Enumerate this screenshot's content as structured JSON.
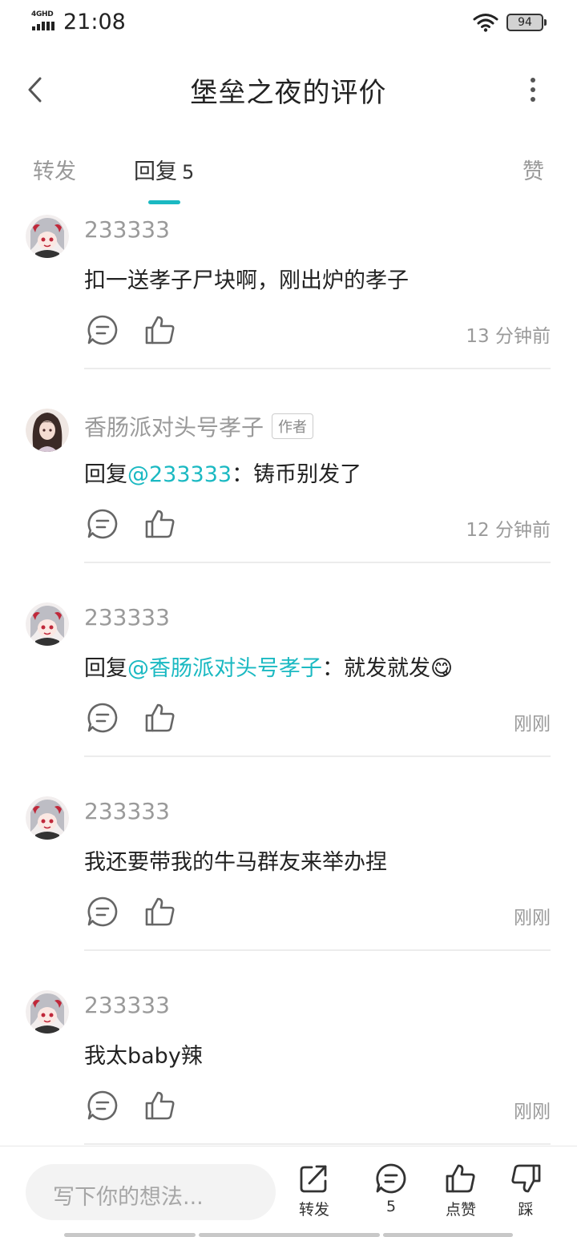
{
  "status_bar": {
    "network": "4GHD",
    "time": "21:08",
    "battery": "94"
  },
  "header": {
    "title": "堡垒之夜的评价"
  },
  "tabs": {
    "forward": "转发",
    "reply": "回复",
    "reply_count": "5",
    "like": "赞"
  },
  "colors": {
    "accent": "#1bb9c2",
    "muted": "#9a9a9a"
  },
  "comments": [
    {
      "user": "233333",
      "badge": "",
      "prefix": "",
      "mention": "",
      "separator": "",
      "text": "扣一送孝子尸块啊，刚出炉的孝子",
      "emoji": "",
      "time": "13 分钟前"
    },
    {
      "user": "香肠派对头号孝子",
      "badge": "作者",
      "prefix": "回复",
      "mention": "@233333",
      "separator": "：",
      "text": "铸币别发了",
      "emoji": "",
      "time": "12 分钟前"
    },
    {
      "user": "233333",
      "badge": "",
      "prefix": "回复",
      "mention": "@香肠派对头号孝子",
      "separator": "：",
      "text": "就发就发",
      "emoji": "😋",
      "time": "刚刚"
    },
    {
      "user": "233333",
      "badge": "",
      "prefix": "",
      "mention": "",
      "separator": "",
      "text": "我还要带我的牛马群友来举办捏",
      "emoji": "",
      "time": "刚刚"
    },
    {
      "user": "233333",
      "badge": "",
      "prefix": "",
      "mention": "",
      "separator": "",
      "text": "我太baby辣",
      "emoji": "",
      "time": "刚刚"
    }
  ],
  "bottom_bar": {
    "input_placeholder": "写下你的想法...",
    "forward_label": "转发",
    "comment_count": "5",
    "like_label": "点赞",
    "dislike_label": "踩"
  }
}
